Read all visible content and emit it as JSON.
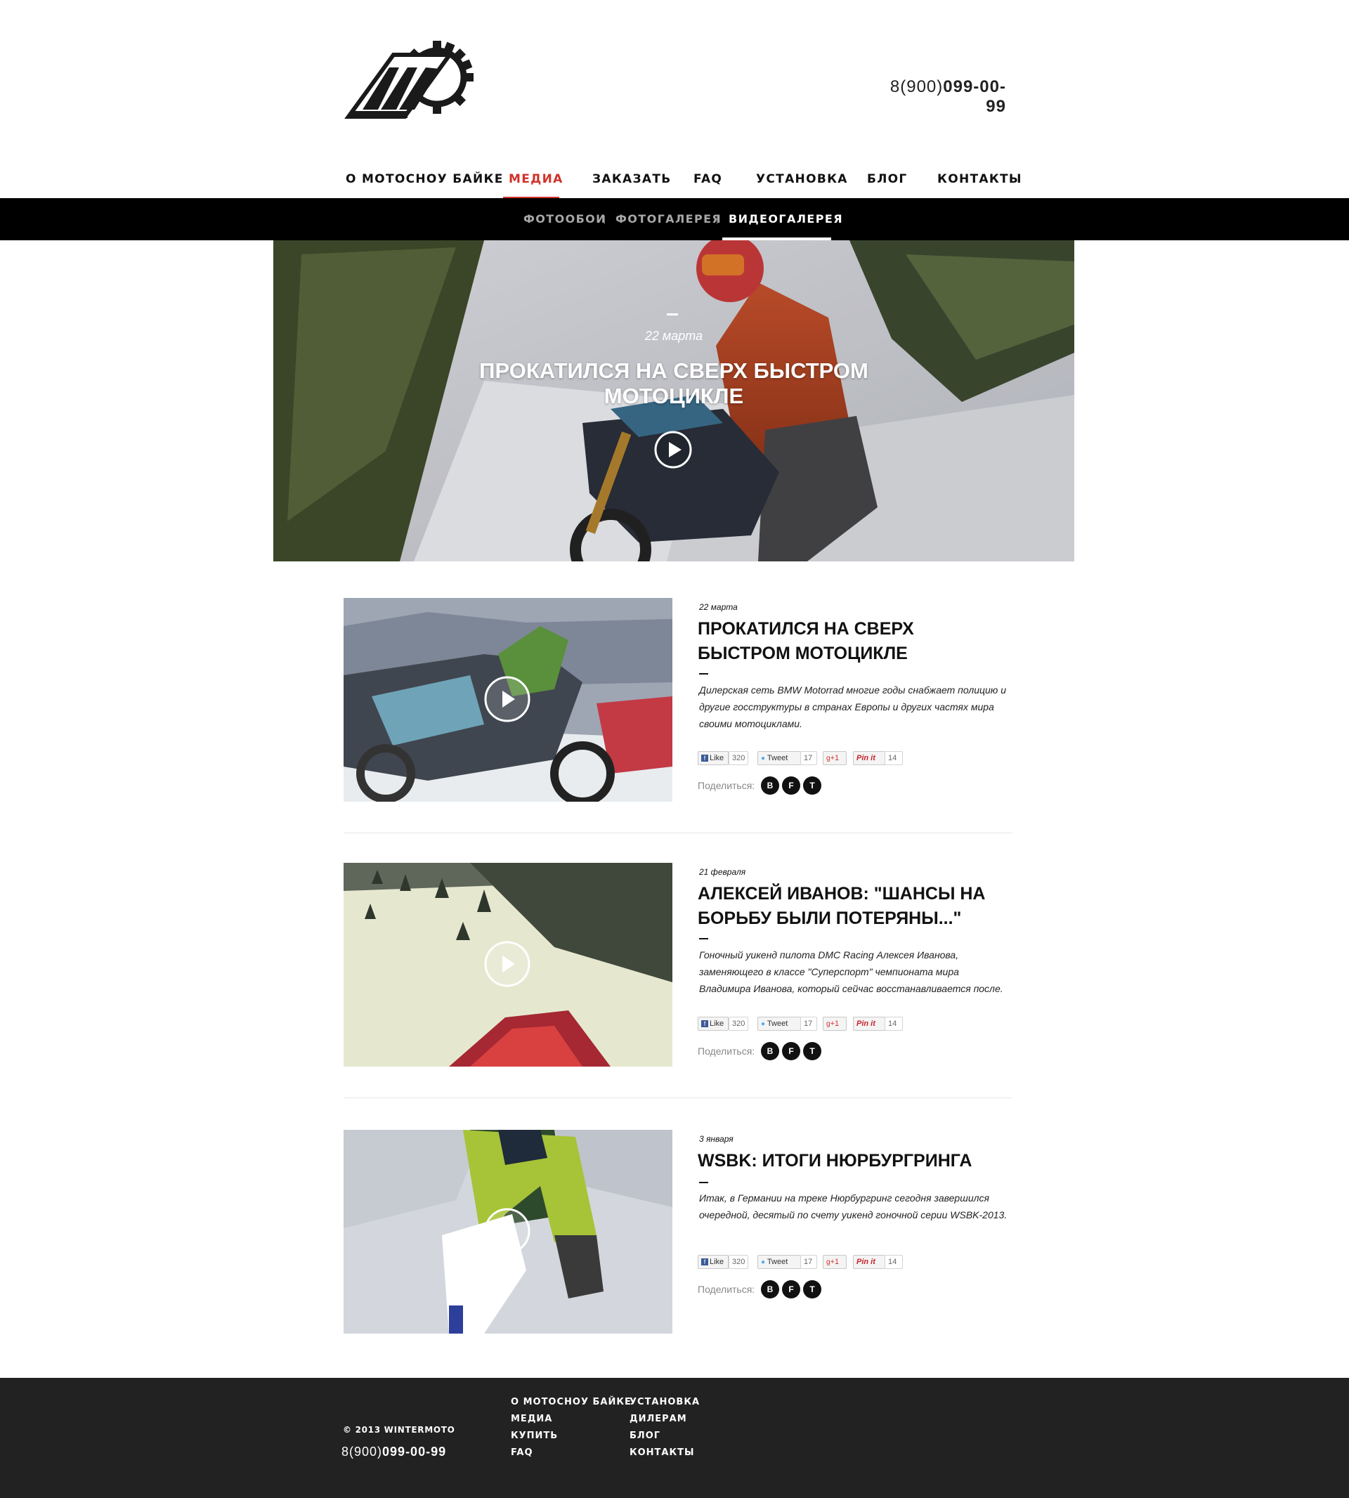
{
  "header": {
    "logo_alt": "MOTOSNOWBIKE.RU",
    "phone_prefix": "8(900)",
    "phone_number": "099-00-99"
  },
  "mainnav": {
    "items": [
      {
        "label": "О мотосноу байке"
      },
      {
        "label": "Медиа",
        "active": true
      },
      {
        "label": "Заказать"
      },
      {
        "label": "FAQ"
      },
      {
        "label": "Установка"
      },
      {
        "label": "Блог"
      },
      {
        "label": "Контакты"
      }
    ]
  },
  "subnav": {
    "items": [
      {
        "label": "Фотообои"
      },
      {
        "label": "Фотогалерея"
      },
      {
        "label": "Видеогалерея",
        "active": true
      }
    ]
  },
  "hero": {
    "date": "22 марта",
    "title": "Прокатился на сверх быстром мотоцикле",
    "play_icon": "play-circle-icon"
  },
  "articles": [
    {
      "date": "22 марта",
      "title": "Прокатился на сверх быстром мотоцикле",
      "text": "Дилерская сеть BMW Motorrad многие годы снабжает полицию и другие госструктуры в странах Европы и других частях мира своими мотоциклами."
    },
    {
      "date": "21 февраля",
      "title": "Алексей Иванов: \"Шансы на борьбу были потеряны...\"",
      "text": "Гоночный уикенд пилота DMC Racing Алексея Иванова, заменяющего в классе \"Суперспорт\" чемпионата мира Владимира Иванова, который сейчас восстанавливается после."
    },
    {
      "date": "3 января",
      "title": "WSBK: итоги Нюрбургринга",
      "text": "Итак, в Германии на треке Нюрбургринг сегодня завершился очередной, десятый по счету уикенд гоночной серии WSBK-2013."
    }
  ],
  "social": {
    "like_label": "Like",
    "like_count": "320",
    "tweet_label": "Tweet",
    "tweet_count": "17",
    "gplus_label": "+1",
    "pin_label": "Pin it",
    "pin_count": "14",
    "share_label": "Поделиться:",
    "share_buttons": [
      "B",
      "F",
      "T"
    ]
  },
  "footer": {
    "copyright": "© 2013 WINTERMOTO",
    "phone_prefix": "8(900)",
    "phone_number": "099-00-99",
    "col1": [
      "О мотосноу байке",
      "Медиа",
      "Купить",
      "FAQ"
    ],
    "col2": [
      "Установка",
      "Дилерам",
      "Блог",
      "Контакты"
    ]
  },
  "colors": {
    "accent": "#d0332b",
    "subnav_bg": "#000000",
    "footer_bg": "#222222"
  }
}
